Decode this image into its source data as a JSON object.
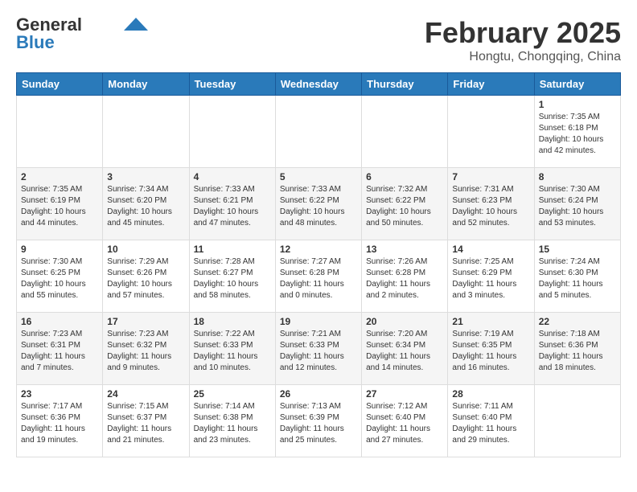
{
  "logo": {
    "general": "General",
    "blue": "Blue"
  },
  "header": {
    "month": "February 2025",
    "location": "Hongtu, Chongqing, China"
  },
  "weekdays": [
    "Sunday",
    "Monday",
    "Tuesday",
    "Wednesday",
    "Thursday",
    "Friday",
    "Saturday"
  ],
  "weeks": [
    [
      {
        "day": "",
        "info": ""
      },
      {
        "day": "",
        "info": ""
      },
      {
        "day": "",
        "info": ""
      },
      {
        "day": "",
        "info": ""
      },
      {
        "day": "",
        "info": ""
      },
      {
        "day": "",
        "info": ""
      },
      {
        "day": "1",
        "info": "Sunrise: 7:35 AM\nSunset: 6:18 PM\nDaylight: 10 hours and 42 minutes."
      }
    ],
    [
      {
        "day": "2",
        "info": "Sunrise: 7:35 AM\nSunset: 6:19 PM\nDaylight: 10 hours and 44 minutes."
      },
      {
        "day": "3",
        "info": "Sunrise: 7:34 AM\nSunset: 6:20 PM\nDaylight: 10 hours and 45 minutes."
      },
      {
        "day": "4",
        "info": "Sunrise: 7:33 AM\nSunset: 6:21 PM\nDaylight: 10 hours and 47 minutes."
      },
      {
        "day": "5",
        "info": "Sunrise: 7:33 AM\nSunset: 6:22 PM\nDaylight: 10 hours and 48 minutes."
      },
      {
        "day": "6",
        "info": "Sunrise: 7:32 AM\nSunset: 6:22 PM\nDaylight: 10 hours and 50 minutes."
      },
      {
        "day": "7",
        "info": "Sunrise: 7:31 AM\nSunset: 6:23 PM\nDaylight: 10 hours and 52 minutes."
      },
      {
        "day": "8",
        "info": "Sunrise: 7:30 AM\nSunset: 6:24 PM\nDaylight: 10 hours and 53 minutes."
      }
    ],
    [
      {
        "day": "9",
        "info": "Sunrise: 7:30 AM\nSunset: 6:25 PM\nDaylight: 10 hours and 55 minutes."
      },
      {
        "day": "10",
        "info": "Sunrise: 7:29 AM\nSunset: 6:26 PM\nDaylight: 10 hours and 57 minutes."
      },
      {
        "day": "11",
        "info": "Sunrise: 7:28 AM\nSunset: 6:27 PM\nDaylight: 10 hours and 58 minutes."
      },
      {
        "day": "12",
        "info": "Sunrise: 7:27 AM\nSunset: 6:28 PM\nDaylight: 11 hours and 0 minutes."
      },
      {
        "day": "13",
        "info": "Sunrise: 7:26 AM\nSunset: 6:28 PM\nDaylight: 11 hours and 2 minutes."
      },
      {
        "day": "14",
        "info": "Sunrise: 7:25 AM\nSunset: 6:29 PM\nDaylight: 11 hours and 3 minutes."
      },
      {
        "day": "15",
        "info": "Sunrise: 7:24 AM\nSunset: 6:30 PM\nDaylight: 11 hours and 5 minutes."
      }
    ],
    [
      {
        "day": "16",
        "info": "Sunrise: 7:23 AM\nSunset: 6:31 PM\nDaylight: 11 hours and 7 minutes."
      },
      {
        "day": "17",
        "info": "Sunrise: 7:23 AM\nSunset: 6:32 PM\nDaylight: 11 hours and 9 minutes."
      },
      {
        "day": "18",
        "info": "Sunrise: 7:22 AM\nSunset: 6:33 PM\nDaylight: 11 hours and 10 minutes."
      },
      {
        "day": "19",
        "info": "Sunrise: 7:21 AM\nSunset: 6:33 PM\nDaylight: 11 hours and 12 minutes."
      },
      {
        "day": "20",
        "info": "Sunrise: 7:20 AM\nSunset: 6:34 PM\nDaylight: 11 hours and 14 minutes."
      },
      {
        "day": "21",
        "info": "Sunrise: 7:19 AM\nSunset: 6:35 PM\nDaylight: 11 hours and 16 minutes."
      },
      {
        "day": "22",
        "info": "Sunrise: 7:18 AM\nSunset: 6:36 PM\nDaylight: 11 hours and 18 minutes."
      }
    ],
    [
      {
        "day": "23",
        "info": "Sunrise: 7:17 AM\nSunset: 6:36 PM\nDaylight: 11 hours and 19 minutes."
      },
      {
        "day": "24",
        "info": "Sunrise: 7:15 AM\nSunset: 6:37 PM\nDaylight: 11 hours and 21 minutes."
      },
      {
        "day": "25",
        "info": "Sunrise: 7:14 AM\nSunset: 6:38 PM\nDaylight: 11 hours and 23 minutes."
      },
      {
        "day": "26",
        "info": "Sunrise: 7:13 AM\nSunset: 6:39 PM\nDaylight: 11 hours and 25 minutes."
      },
      {
        "day": "27",
        "info": "Sunrise: 7:12 AM\nSunset: 6:40 PM\nDaylight: 11 hours and 27 minutes."
      },
      {
        "day": "28",
        "info": "Sunrise: 7:11 AM\nSunset: 6:40 PM\nDaylight: 11 hours and 29 minutes."
      },
      {
        "day": "",
        "info": ""
      }
    ]
  ]
}
